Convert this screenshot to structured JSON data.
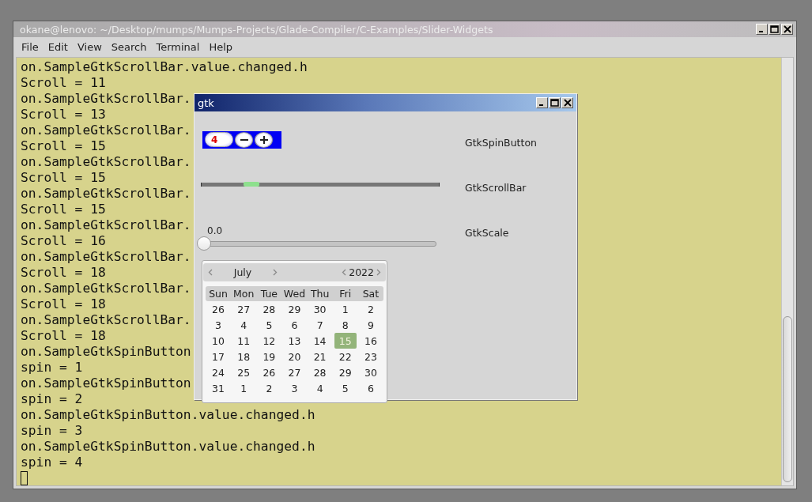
{
  "terminal": {
    "title": "okane@lenovo: ~/Desktop/mumps/Mumps-Projects/Glade-Compiler/C-Examples/Slider-Widgets",
    "menu": [
      "File",
      "Edit",
      "View",
      "Search",
      "Terminal",
      "Help"
    ],
    "lines": [
      "on.SampleGtkScrollBar.value.changed.h",
      "Scroll = 11",
      "on.SampleGtkScrollBar.",
      "Scroll = 13",
      "on.SampleGtkScrollBar.",
      "Scroll = 15",
      "on.SampleGtkScrollBar.",
      "Scroll = 15",
      "on.SampleGtkScrollBar.",
      "Scroll = 15",
      "on.SampleGtkScrollBar.",
      "Scroll = 16",
      "on.SampleGtkScrollBar.",
      "Scroll = 18",
      "on.SampleGtkScrollBar.",
      "Scroll = 18",
      "on.SampleGtkScrollBar.",
      "Scroll = 18",
      "on.SampleGtkSpinButton",
      "spin = 1",
      "on.SampleGtkSpinButton",
      "spin = 2",
      "on.SampleGtkSpinButton.value.changed.h",
      "spin = 3",
      "on.SampleGtkSpinButton.value.changed.h",
      "spin = 4"
    ]
  },
  "gtk_window": {
    "title": "gtk",
    "spin_button": {
      "value": "4",
      "label": "GtkSpinButton"
    },
    "scrollbar": {
      "label": "GtkScrollBar"
    },
    "scale": {
      "reading": "0.0",
      "level": 0,
      "label": "GtkScale"
    },
    "calendar": {
      "month": "July",
      "year": "2022",
      "weekdays": [
        "Sun",
        "Mon",
        "Tue",
        "Wed",
        "Thu",
        "Fri",
        "Sat"
      ],
      "weeks": [
        [
          {
            "day": "26",
            "selected": false
          },
          {
            "day": "27",
            "selected": false
          },
          {
            "day": "28",
            "selected": false
          },
          {
            "day": "29",
            "selected": false
          },
          {
            "day": "30",
            "selected": false
          },
          {
            "day": "1",
            "selected": false
          },
          {
            "day": "2",
            "selected": false
          }
        ],
        [
          {
            "day": "3",
            "selected": false
          },
          {
            "day": "4",
            "selected": false
          },
          {
            "day": "5",
            "selected": false
          },
          {
            "day": "6",
            "selected": false
          },
          {
            "day": "7",
            "selected": false
          },
          {
            "day": "8",
            "selected": false
          },
          {
            "day": "9",
            "selected": false
          }
        ],
        [
          {
            "day": "10",
            "selected": false
          },
          {
            "day": "11",
            "selected": false
          },
          {
            "day": "12",
            "selected": false
          },
          {
            "day": "13",
            "selected": false
          },
          {
            "day": "14",
            "selected": false
          },
          {
            "day": "15",
            "selected": true
          },
          {
            "day": "16",
            "selected": false
          }
        ],
        [
          {
            "day": "17",
            "selected": false
          },
          {
            "day": "18",
            "selected": false
          },
          {
            "day": "19",
            "selected": false
          },
          {
            "day": "20",
            "selected": false
          },
          {
            "day": "21",
            "selected": false
          },
          {
            "day": "22",
            "selected": false
          },
          {
            "day": "23",
            "selected": false
          }
        ],
        [
          {
            "day": "24",
            "selected": false
          },
          {
            "day": "25",
            "selected": false
          },
          {
            "day": "26",
            "selected": false
          },
          {
            "day": "27",
            "selected": false
          },
          {
            "day": "28",
            "selected": false
          },
          {
            "day": "29",
            "selected": false
          },
          {
            "day": "30",
            "selected": false
          }
        ],
        [
          {
            "day": "31",
            "selected": false
          },
          {
            "day": "1",
            "selected": false
          },
          {
            "day": "2",
            "selected": false
          },
          {
            "day": "3",
            "selected": false
          },
          {
            "day": "4",
            "selected": false
          },
          {
            "day": "5",
            "selected": false
          },
          {
            "day": "6",
            "selected": false
          }
        ]
      ]
    }
  }
}
